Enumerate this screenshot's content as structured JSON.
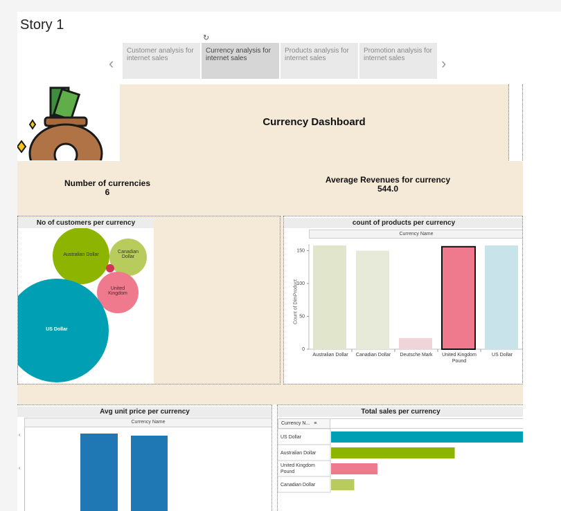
{
  "story": {
    "title": "Story 1"
  },
  "tabs": [
    {
      "label": "Customer analysis for internet sales"
    },
    {
      "label": "Currency analysis for internet sales"
    },
    {
      "label": "Products analysis for internet sales"
    },
    {
      "label": "Promotion analysis for internet sales"
    }
  ],
  "dashboard": {
    "title": "Currency Dashboard",
    "kpi_count_label": "Number of currencies",
    "kpi_count_value": "6",
    "kpi_avg_label": "Average Revenues for currency",
    "kpi_avg_value": "544.0"
  },
  "customers_panel": {
    "title": "No of customers per currency",
    "bubbles": [
      {
        "label": "Australian Dollar",
        "color": "#8db500"
      },
      {
        "label": "Canadian Dollar",
        "color": "#b8cc5e"
      },
      {
        "label": "United Kingdom",
        "color": "#f07a8d"
      },
      {
        "label": "US Dollar",
        "color": "#009fb3"
      },
      {
        "label": "",
        "color": "#d23553"
      }
    ]
  },
  "products_panel": {
    "title": "count of products per currency",
    "header": "Currency Name",
    "ylabel": "Count of DimProduct"
  },
  "avg_price_panel": {
    "title": "Avg unit price per currency",
    "header": "Currency Name",
    "color": "#1f77b4"
  },
  "sales_panel": {
    "title": "Total sales per currency",
    "header": "Currency N...",
    "sort_icon": "sort-icon"
  },
  "chart_data": [
    {
      "type": "bar",
      "title": "count of products per currency",
      "xlabel": "Currency Name",
      "ylabel": "Count of DimProduct",
      "categories": [
        "Australian Dollar",
        "Canadian Dollar",
        "Deutsche Mark",
        "United Kingdom Pound",
        "US Dollar"
      ],
      "values": [
        158,
        150,
        17,
        156,
        158
      ],
      "colors": [
        "#e0e5cc",
        "#e7ead9",
        "#efd4d9",
        "#f07a8d",
        "#c8e4ea"
      ],
      "yticks": [
        0,
        50,
        100,
        150
      ],
      "ylim": [
        0,
        160
      ]
    },
    {
      "type": "bar",
      "orientation": "horizontal",
      "title": "Total sales per currency",
      "categories": [
        "US Dollar",
        "Australian Dollar",
        "United Kingdom Pound",
        "Canadian Dollar"
      ],
      "values": [
        1.0,
        0.64,
        0.24,
        0.12
      ],
      "colors": [
        "#009fb3",
        "#8db500",
        "#f07a8d",
        "#b8cc5e"
      ]
    }
  ]
}
